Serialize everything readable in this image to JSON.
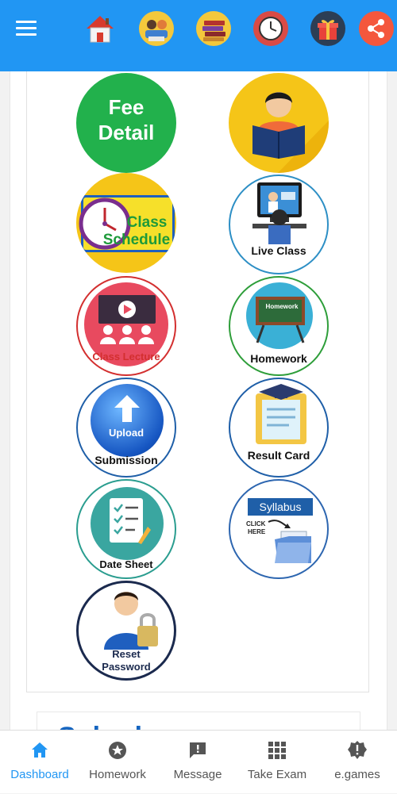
{
  "topbar": {
    "icons": [
      "home-icon",
      "students-icon",
      "books-icon",
      "clock-icon",
      "gift-icon",
      "share-icon"
    ]
  },
  "colors": {
    "primary": "#2196f3",
    "fee_green": "#22b14c",
    "yellow": "#f5c518",
    "red": "#e0373b",
    "teal": "#3aa6a0"
  },
  "tiles": {
    "fee_detail": {
      "line1": "Fee",
      "line2": "Detail"
    },
    "class_schedule": {
      "line1": "Class",
      "line2": "Schedule"
    },
    "live_class": {
      "label": "Live Class"
    },
    "class_lecture": {
      "label": "Class Lecture"
    },
    "homework": {
      "label": "Homework",
      "board": "Homework"
    },
    "submission": {
      "label": "Submission",
      "badge": "Upload"
    },
    "result_card": {
      "label": "Result Card"
    },
    "date_sheet": {
      "label": "Date Sheet"
    },
    "syllabus": {
      "label": "Syllabus",
      "click": "CLICK",
      "here": "HERE"
    },
    "reset_password": {
      "line1": "Reset",
      "line2": "Password"
    }
  },
  "second_card": {
    "title": "Schedu"
  },
  "bottom_nav": [
    {
      "label": "Dashboard",
      "icon": "home-icon",
      "active": true
    },
    {
      "label": "Homework",
      "icon": "star-icon",
      "active": false
    },
    {
      "label": "Message",
      "icon": "message-icon",
      "active": false
    },
    {
      "label": "Take Exam",
      "icon": "grid-icon",
      "active": false
    },
    {
      "label": "e.games",
      "icon": "badge-icon",
      "active": false
    }
  ]
}
